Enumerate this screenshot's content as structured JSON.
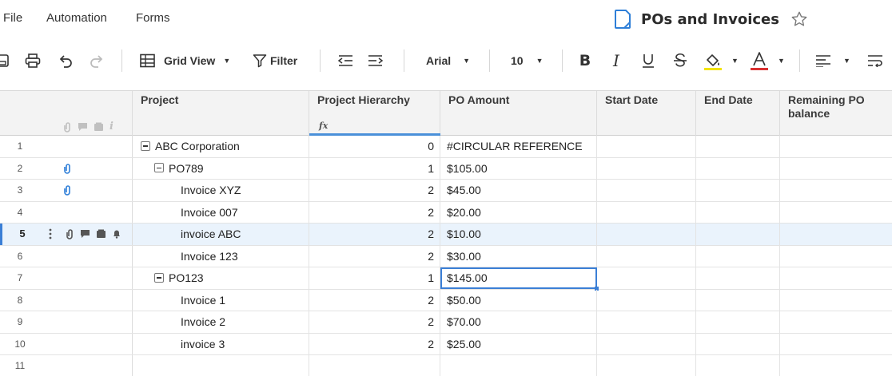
{
  "menu": [
    "File",
    "Automation",
    "Forms"
  ],
  "document": {
    "title": "POs and Invoices",
    "accent": "#2f7fd8"
  },
  "toolbar": {
    "view_label": "Grid View",
    "filter_label": "Filter",
    "font_name": "Arial",
    "font_size": "10",
    "highlight_color": "#f2e300",
    "text_color": "#d93030"
  },
  "columns": [
    "Project",
    "Project Hierarchy",
    "PO Amount",
    "Start Date",
    "End Date",
    "Remaining PO balance"
  ],
  "formula_marker": "fx",
  "rows": [
    {
      "num": "1",
      "project": "ABC Corporation",
      "level": 0,
      "collapsible": true,
      "hierarchy": "0",
      "po": "#CIRCULAR REFERENCE",
      "start": "",
      "end": "",
      "remaining": "",
      "attachment": false
    },
    {
      "num": "2",
      "project": "PO789",
      "level": 1,
      "collapsible": true,
      "hierarchy": "1",
      "po": "$105.00",
      "start": "",
      "end": "",
      "remaining": "",
      "attachment": true
    },
    {
      "num": "3",
      "project": "Invoice XYZ",
      "level": 2,
      "collapsible": false,
      "hierarchy": "2",
      "po": "$45.00",
      "start": "",
      "end": "",
      "remaining": "",
      "attachment": true
    },
    {
      "num": "4",
      "project": "Invoice 007",
      "level": 2,
      "collapsible": false,
      "hierarchy": "2",
      "po": "$20.00",
      "start": "",
      "end": "",
      "remaining": "",
      "attachment": false
    },
    {
      "num": "5",
      "project": "invoice ABC",
      "level": 2,
      "collapsible": false,
      "hierarchy": "2",
      "po": "$10.00",
      "start": "",
      "end": "",
      "remaining": "",
      "attachment": false,
      "selected": true
    },
    {
      "num": "6",
      "project": "Invoice 123",
      "level": 2,
      "collapsible": false,
      "hierarchy": "2",
      "po": "$30.00",
      "start": "",
      "end": "",
      "remaining": "",
      "attachment": false
    },
    {
      "num": "7",
      "project": "PO123",
      "level": 1,
      "collapsible": true,
      "hierarchy": "1",
      "po": "$145.00",
      "start": "",
      "end": "",
      "remaining": "",
      "attachment": false,
      "active_cell": true
    },
    {
      "num": "8",
      "project": "Invoice 1",
      "level": 2,
      "collapsible": false,
      "hierarchy": "2",
      "po": "$50.00",
      "start": "",
      "end": "",
      "remaining": "",
      "attachment": false
    },
    {
      "num": "9",
      "project": "Invoice 2",
      "level": 2,
      "collapsible": false,
      "hierarchy": "2",
      "po": "$70.00",
      "start": "",
      "end": "",
      "remaining": "",
      "attachment": false
    },
    {
      "num": "10",
      "project": "invoice 3",
      "level": 2,
      "collapsible": false,
      "hierarchy": "2",
      "po": "$25.00",
      "start": "",
      "end": "",
      "remaining": "",
      "attachment": false
    },
    {
      "num": "11",
      "project": "",
      "level": 0,
      "collapsible": false,
      "hierarchy": "",
      "po": "",
      "start": "",
      "end": "",
      "remaining": "",
      "attachment": false
    }
  ]
}
